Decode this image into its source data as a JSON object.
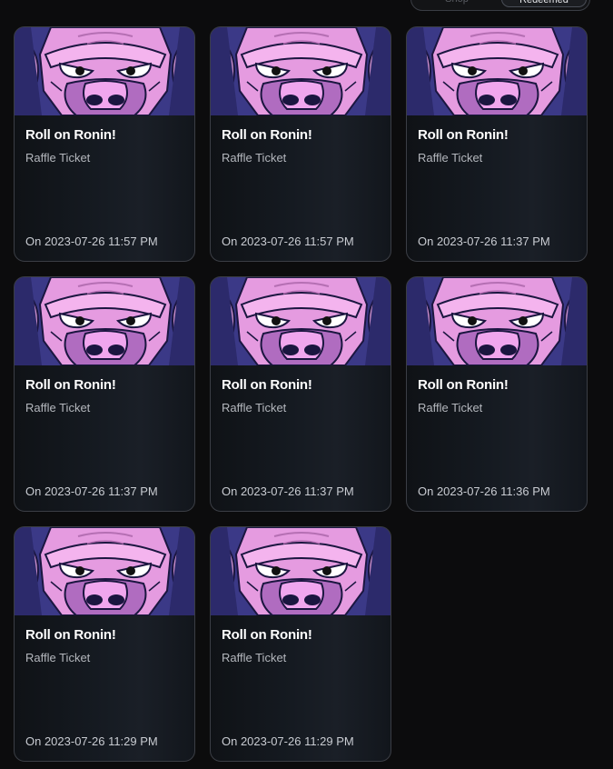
{
  "toggle": {
    "options": [
      "Shop",
      "Redeemed"
    ],
    "selected": "Redeemed"
  },
  "colors": {
    "background": "#0c0c0d",
    "card_border": "#3b3e45",
    "title": "#ffffff",
    "subtitle": "#b4b7bd"
  },
  "cards": [
    {
      "title": "Roll on Ronin!",
      "subtitle": "Raffle Ticket",
      "date": "On 2023-07-26 11:57 PM",
      "image": "gorilla-face-art"
    },
    {
      "title": "Roll on Ronin!",
      "subtitle": "Raffle Ticket",
      "date": "On 2023-07-26 11:57 PM",
      "image": "gorilla-face-art"
    },
    {
      "title": "Roll on Ronin!",
      "subtitle": "Raffle Ticket",
      "date": "On 2023-07-26 11:37 PM",
      "image": "gorilla-face-art"
    },
    {
      "title": "Roll on Ronin!",
      "subtitle": "Raffle Ticket",
      "date": "On 2023-07-26 11:37 PM",
      "image": "gorilla-face-art"
    },
    {
      "title": "Roll on Ronin!",
      "subtitle": "Raffle Ticket",
      "date": "On 2023-07-26 11:37 PM",
      "image": "gorilla-face-art"
    },
    {
      "title": "Roll on Ronin!",
      "subtitle": "Raffle Ticket",
      "date": "On 2023-07-26 11:36 PM",
      "image": "gorilla-face-art"
    },
    {
      "title": "Roll on Ronin!",
      "subtitle": "Raffle Ticket",
      "date": "On 2023-07-26 11:29 PM",
      "image": "gorilla-face-art"
    },
    {
      "title": "Roll on Ronin!",
      "subtitle": "Raffle Ticket",
      "date": "On 2023-07-26 11:29 PM",
      "image": "gorilla-face-art"
    }
  ]
}
